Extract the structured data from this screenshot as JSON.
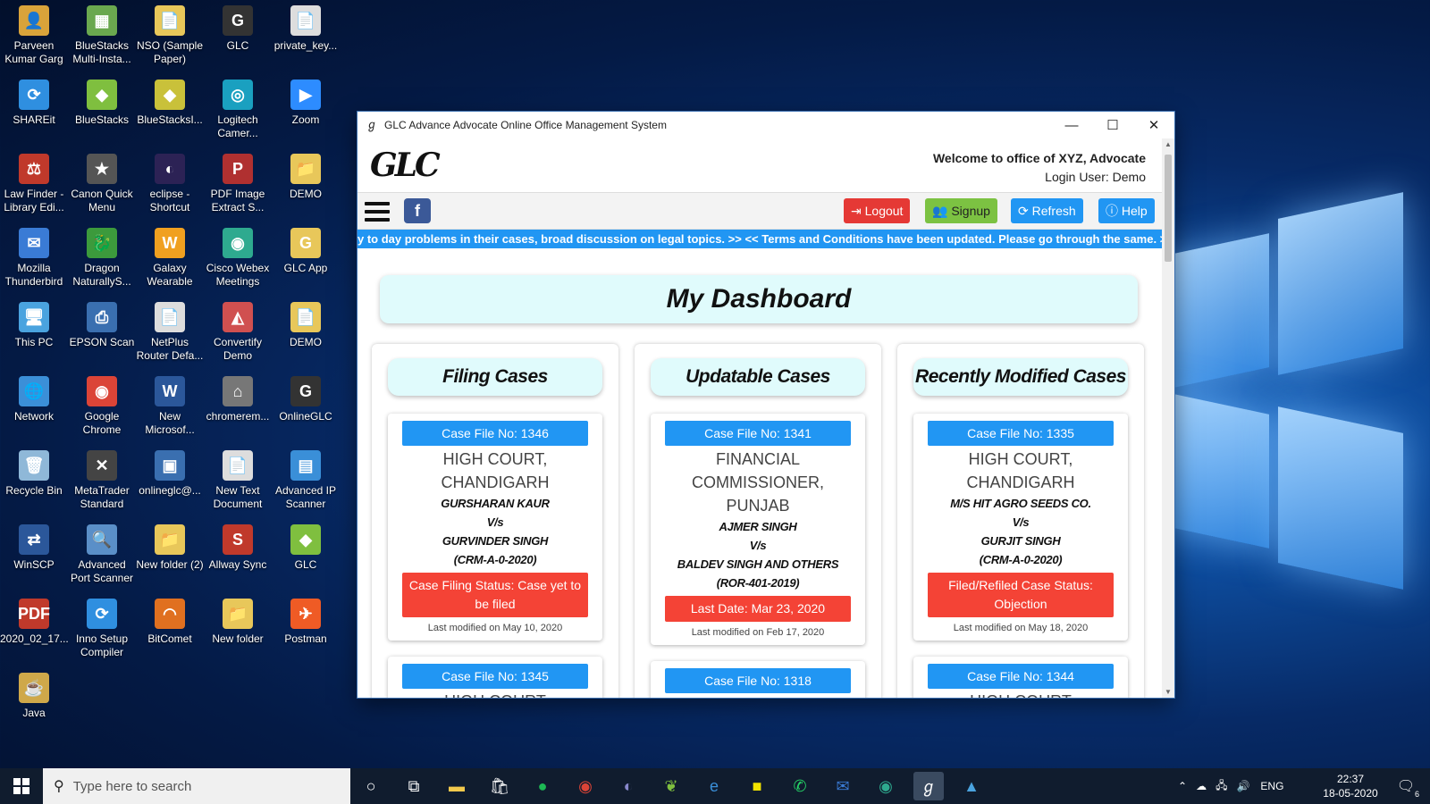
{
  "desktop": {
    "icons": [
      {
        "label": "Parveen Kumar Garg",
        "glyph": "👤",
        "color": "#d9a33a"
      },
      {
        "label": "BlueStacks Multi-Insta...",
        "glyph": "▦",
        "color": "#6aa84f"
      },
      {
        "label": "NSO (Sample Paper)",
        "glyph": "📄",
        "color": "#e8c75a"
      },
      {
        "label": "GLC",
        "glyph": "G",
        "color": "#333333"
      },
      {
        "label": "private_key...",
        "glyph": "📄",
        "color": "#dddddd"
      },
      {
        "label": "SHAREit",
        "glyph": "⟳",
        "color": "#2f8fe0"
      },
      {
        "label": "BlueStacks",
        "glyph": "◆",
        "color": "#7fbf3f"
      },
      {
        "label": "BlueStacksI...",
        "glyph": "◆",
        "color": "#c9c13a"
      },
      {
        "label": "Logitech Camer...",
        "glyph": "◎",
        "color": "#1aa0c0"
      },
      {
        "label": "Zoom",
        "glyph": "▶",
        "color": "#2d8cff"
      },
      {
        "label": "Law Finder - Library Edi...",
        "glyph": "⚖",
        "color": "#c0392b"
      },
      {
        "label": "Canon Quick Menu",
        "glyph": "★",
        "color": "#555555"
      },
      {
        "label": "eclipse - Shortcut",
        "glyph": "◐",
        "color": "#2c2255"
      },
      {
        "label": "PDF Image Extract S...",
        "glyph": "P",
        "color": "#b03030"
      },
      {
        "label": "DEMO",
        "glyph": "📁",
        "color": "#e8c75a"
      },
      {
        "label": "Mozilla Thunderbird",
        "glyph": "✉",
        "color": "#3a7bd5"
      },
      {
        "label": "Dragon NaturallyS...",
        "glyph": "🐉",
        "color": "#3c9a3c"
      },
      {
        "label": "Galaxy Wearable",
        "glyph": "W",
        "color": "#f0a020"
      },
      {
        "label": "Cisco Webex Meetings",
        "glyph": "◉",
        "color": "#2eaa8f"
      },
      {
        "label": "GLC App",
        "glyph": "G",
        "color": "#e8c75a"
      },
      {
        "label": "This PC",
        "glyph": "🖥",
        "color": "#4aa3df"
      },
      {
        "label": "EPSON Scan",
        "glyph": "⎙",
        "color": "#3a6fb0"
      },
      {
        "label": "NetPlus Router Defa...",
        "glyph": "📄",
        "color": "#dddddd"
      },
      {
        "label": "Convertify Demo",
        "glyph": "◭",
        "color": "#d05050"
      },
      {
        "label": "DEMO",
        "glyph": "📄",
        "color": "#e8c75a"
      },
      {
        "label": "Network",
        "glyph": "🌐",
        "color": "#3b8fd8"
      },
      {
        "label": "Google Chrome",
        "glyph": "◉",
        "color": "#db4437"
      },
      {
        "label": "New Microsof...",
        "glyph": "W",
        "color": "#2b579a"
      },
      {
        "label": "chromerem...",
        "glyph": "⌂",
        "color": "#777777"
      },
      {
        "label": "OnlineGLC",
        "glyph": "G",
        "color": "#333333"
      },
      {
        "label": "Recycle Bin",
        "glyph": "🗑",
        "color": "#8fb8d8"
      },
      {
        "label": "MetaTrader Standard",
        "glyph": "✕",
        "color": "#444444"
      },
      {
        "label": "onlineglc@...",
        "glyph": "▣",
        "color": "#3a6fb0"
      },
      {
        "label": "New Text Document",
        "glyph": "📄",
        "color": "#dddddd"
      },
      {
        "label": "Advanced IP Scanner",
        "glyph": "▤",
        "color": "#3a8fd8"
      },
      {
        "label": "WinSCP",
        "glyph": "⇄",
        "color": "#2b579a"
      },
      {
        "label": "Advanced Port Scanner",
        "glyph": "🔍",
        "color": "#5a8fc8"
      },
      {
        "label": "New folder (2)",
        "glyph": "📁",
        "color": "#e8c75a"
      },
      {
        "label": "Allway Sync",
        "glyph": "S",
        "color": "#c0392b"
      },
      {
        "label": "GLC",
        "glyph": "◆",
        "color": "#7fbf3f"
      },
      {
        "label": "2020_02_17...",
        "glyph": "PDF",
        "color": "#c0392b"
      },
      {
        "label": "Inno Setup Compiler",
        "glyph": "⟳",
        "color": "#2f8fe0"
      },
      {
        "label": "BitComet",
        "glyph": "◠",
        "color": "#e07020"
      },
      {
        "label": "New folder",
        "glyph": "📁",
        "color": "#e8c75a"
      },
      {
        "label": "Postman",
        "glyph": "✈",
        "color": "#ef5b25"
      },
      {
        "label": "Java",
        "glyph": "☕",
        "color": "#cfa84a"
      }
    ]
  },
  "window": {
    "title": "GLC Advance Advocate Online Office Management System",
    "controls": {
      "minimize": "—",
      "maximize": "☐",
      "close": "✕"
    }
  },
  "header": {
    "logo_text": "GLC",
    "welcome": "Welcome to office of XYZ, Advocate",
    "login_user": "Login User: Demo"
  },
  "nav": {
    "fb_label": "f",
    "logout": "Logout",
    "signup": "Signup",
    "refresh": "Refresh",
    "help": "Help",
    "logout_icon": "⇥",
    "signup_icon": "👥",
    "refresh_icon": "⟳",
    "help_icon": "ⓘ"
  },
  "ticker": "y to day problems in their cases, broad discussion on legal topics. >> << Terms and Conditions have been updated. Please go through the same. >>",
  "dashboard": {
    "title": "My Dashboard",
    "columns": [
      {
        "heading": "Filing Cases",
        "cards": [
          {
            "case_no": "Case File No: 1346",
            "court": "HIGH COURT, CHANDIGARH",
            "petitioner": "GURSHARAN KAUR",
            "vs": "V/s",
            "respondent": "GURVINDER SINGH",
            "case_ref": "(CRM-A-0-2020)",
            "status": "Case Filing Status: Case yet to be filed",
            "modified": "Last modified on May 10, 2020"
          },
          {
            "case_no": "Case File No: 1345",
            "court": "HIGH COURT"
          }
        ]
      },
      {
        "heading": "Updatable Cases",
        "cards": [
          {
            "case_no": "Case File No: 1341",
            "court": "FINANCIAL COMMISSIONER, PUNJAB",
            "petitioner": "AJMER SINGH",
            "vs": "V/s",
            "respondent": "BALDEV SINGH AND OTHERS",
            "case_ref": "(ROR-401-2019)",
            "status": "Last Date: Mar 23, 2020",
            "modified": "Last modified on Feb 17, 2020"
          },
          {
            "case_no": "Case File No: 1318",
            "court": "FINANCIAL"
          }
        ]
      },
      {
        "heading": "Recently Modified Cases",
        "cards": [
          {
            "case_no": "Case File No: 1335",
            "court": "HIGH COURT, CHANDIGARH",
            "petitioner": "M/S HIT AGRO SEEDS CO.",
            "vs": "V/s",
            "respondent": "GURJIT SINGH",
            "case_ref": "(CRM-A-0-2020)",
            "status": "Filed/Refiled Case Status: Objection",
            "modified": "Last modified on May 18, 2020"
          },
          {
            "case_no": "Case File No: 1344",
            "court": "HIGH COURT"
          }
        ]
      }
    ]
  },
  "taskbar": {
    "search_placeholder": "Type here to search",
    "tray_lang": "ENG",
    "time": "22:37",
    "date": "18-05-2020",
    "notifications": "6"
  }
}
